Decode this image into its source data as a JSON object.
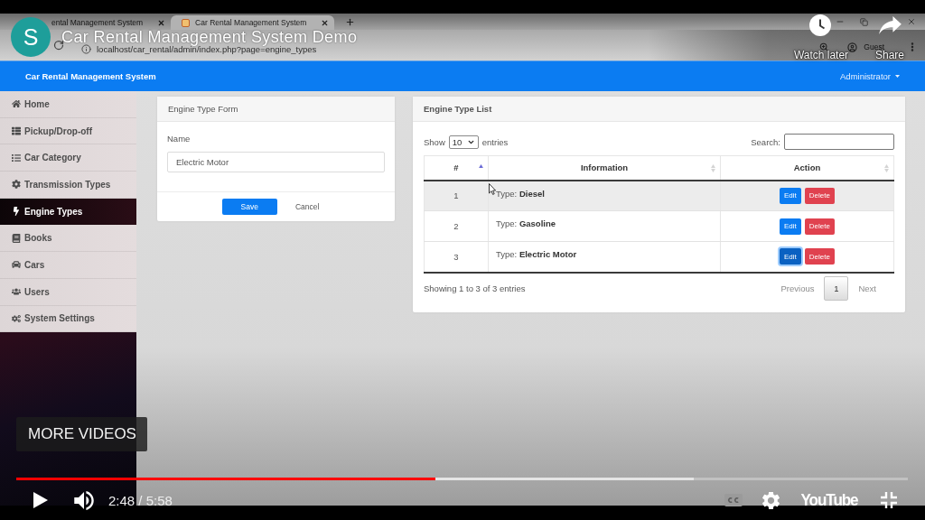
{
  "browser": {
    "tabs": [
      {
        "title": "ental Management System",
        "selected": false
      },
      {
        "title": "Car Rental Management System",
        "selected": true,
        "favicon": true
      }
    ],
    "address": "localhost/car_rental/admin/index.php?page=engine_types",
    "profile": "Guest"
  },
  "app": {
    "brand": "Car Rental Management System",
    "user_menu": "Administrator",
    "sidebar": {
      "items": [
        {
          "label": "Home",
          "selected": false
        },
        {
          "label": "Pickup/Drop-off",
          "selected": false
        },
        {
          "label": "Car Category",
          "selected": false
        },
        {
          "label": "Transmission Types",
          "selected": false
        },
        {
          "label": "Engine Types",
          "selected": true
        },
        {
          "label": "Books",
          "selected": false
        },
        {
          "label": "Cars",
          "selected": false
        },
        {
          "label": "Users",
          "selected": false
        },
        {
          "label": "System Settings",
          "selected": false
        }
      ]
    },
    "form": {
      "title": "Engine Type Form",
      "field": {
        "label": "Name",
        "value": "Electric Motor"
      },
      "buttons": [
        {
          "label": "Save",
          "kind": "save"
        },
        {
          "label": "Cancel",
          "kind": "cancel"
        }
      ]
    },
    "list": {
      "title": "Engine Type List",
      "length_menu": {
        "before": "Show",
        "value": "10",
        "after": "entries"
      },
      "search": {
        "label": "Search:"
      },
      "columns": [
        {
          "label": "#",
          "sorted": true
        },
        {
          "label": "Information",
          "sorted": false
        },
        {
          "label": "Action",
          "sorted": false
        }
      ],
      "rows": [
        {
          "number": "1",
          "information": "Type: **Diesel**",
          "hovered": true,
          "actions": [
            {
              "label": "Edit",
              "kind": "edit",
              "focused": false
            },
            {
              "label": "Delete",
              "kind": "delete",
              "focused": false
            }
          ]
        },
        {
          "number": "2",
          "information": "Type: **Gasoline**",
          "hovered": false,
          "actions": [
            {
              "label": "Edit",
              "kind": "edit",
              "focused": false
            },
            {
              "label": "Delete",
              "kind": "delete",
              "focused": false
            }
          ]
        },
        {
          "number": "3",
          "information": "Type: **Electric Motor**",
          "hovered": false,
          "actions": [
            {
              "label": "Edit",
              "kind": "edit",
              "focused": true
            },
            {
              "label": "Delete",
              "kind": "delete",
              "focused": false
            }
          ]
        }
      ],
      "info": "Showing 1 to 3 of 3 entries",
      "pagination": [
        {
          "label": "Previous",
          "kind": "previous",
          "selected": false,
          "disabled": true
        },
        {
          "label": "1",
          "kind": "page",
          "selected": true,
          "disabled": false
        },
        {
          "label": "Next",
          "kind": "next",
          "selected": false,
          "disabled": true
        }
      ]
    }
  },
  "player": {
    "channel_avatar": "S",
    "title": "Car Rental Management System Demo",
    "watch_later": "Watch later",
    "share": "Share",
    "more_videos": "MORE VIDEOS",
    "progress": {
      "level": 0.47,
      "buffered": {
        "level": 0.76
      }
    },
    "paused": true,
    "time": "2:48 / 5:58",
    "logo": "YouTube"
  }
}
